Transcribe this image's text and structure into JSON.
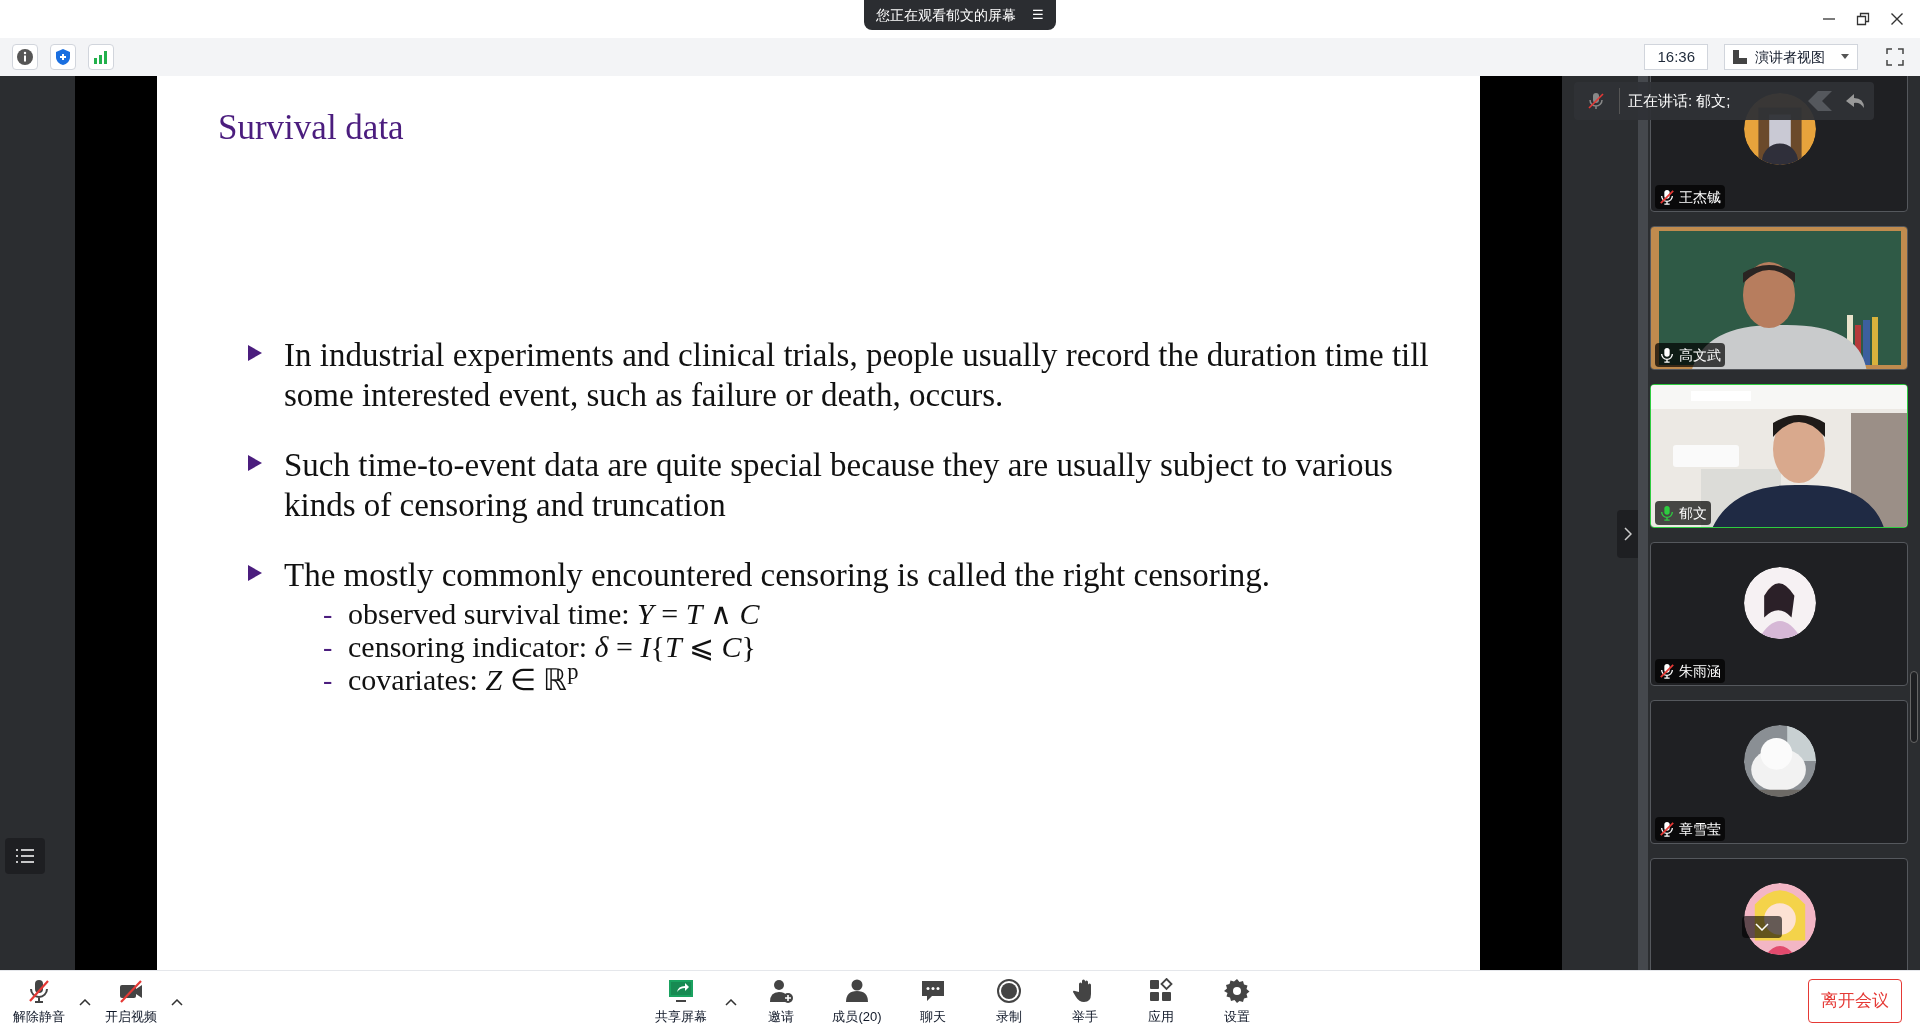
{
  "banner": {
    "text": "您正在观看郁文的屏幕",
    "menu_glyph": "☰"
  },
  "toolbar": {
    "time": "16:36",
    "view_button": "演讲者视图"
  },
  "slide": {
    "title": "Survival data",
    "bullets": [
      {
        "text": "In industrial experiments and clinical trials, people usually record the duration time till some interested event, such as failure or death, occurs."
      },
      {
        "text": "Such time-to-event data are quite special because they are usually subject to various kinds of censoring and truncation"
      },
      {
        "text": "The mostly commonly encountered censoring is called the right censoring.",
        "children": [
          {
            "marker": "-",
            "text": "observed survival time: *Y* = *T* ∧ *C*"
          },
          {
            "marker": "-",
            "text": "censoring indicator: *δ* = *I*{*T* ⩽ *C*}"
          },
          {
            "marker": "-",
            "text": "covariates: *Z* ∈ ℝ$^{p}$"
          }
        ]
      }
    ]
  },
  "speaking_bar": {
    "text": "正在讲话: 郁文;"
  },
  "participants": [
    {
      "name": "王杰铖",
      "kind": "avatar",
      "muted": true,
      "speaking": false
    },
    {
      "name": "高文武",
      "kind": "video",
      "muted": false,
      "speaking": false
    },
    {
      "name": "郁文",
      "kind": "video",
      "muted": false,
      "speaking": true
    },
    {
      "name": "朱雨涵",
      "kind": "avatar",
      "muted": true,
      "speaking": false
    },
    {
      "name": "章雪莹",
      "kind": "avatar",
      "muted": true,
      "speaking": false
    },
    {
      "kind": "avatar"
    }
  ],
  "bottom_bar": {
    "left": [
      {
        "label": "解除静音",
        "kind": "mic"
      },
      {
        "label": "开启视频",
        "kind": "camera"
      }
    ],
    "center": [
      {
        "label": "共享屏幕",
        "kind": "share"
      },
      {
        "label": "邀请",
        "kind": "invite"
      },
      {
        "label": "成员(20)",
        "kind": "members"
      },
      {
        "label": "聊天",
        "kind": "chat"
      },
      {
        "label": "录制",
        "kind": "record"
      },
      {
        "label": "举手",
        "kind": "hand"
      },
      {
        "label": "应用",
        "kind": "apps"
      },
      {
        "label": "设置",
        "kind": "settings"
      }
    ],
    "leave_button": "离开会议"
  }
}
